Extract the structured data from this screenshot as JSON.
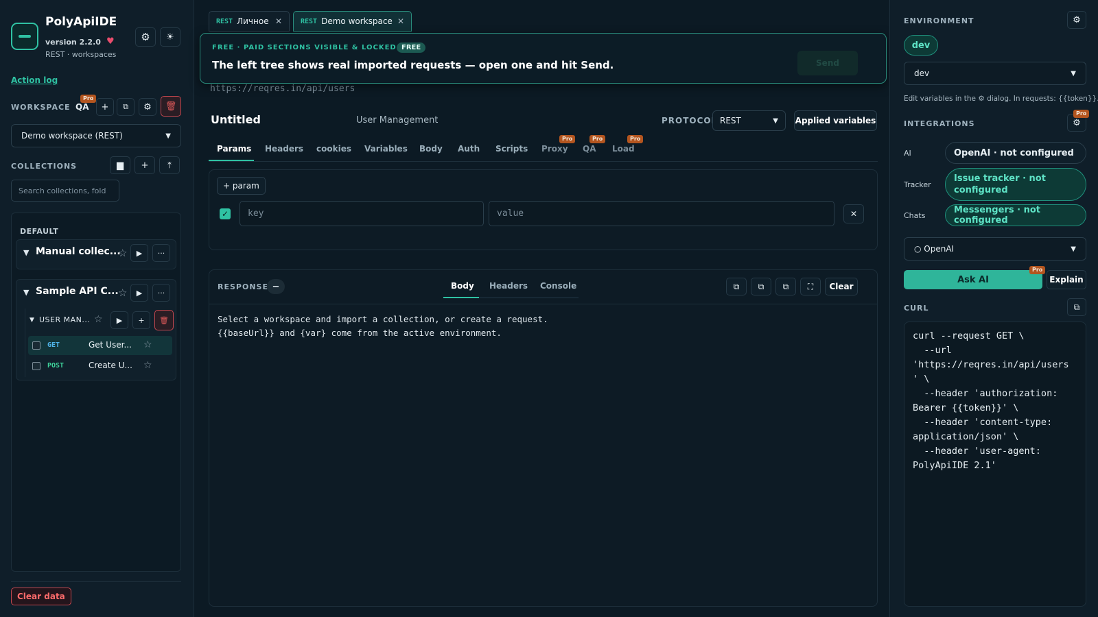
{
  "app": {
    "name": "PolyApiIDE",
    "version": "version 2.2.0",
    "subtitle": "REST · workspaces"
  },
  "sidebar": {
    "action_log": "Action log",
    "workspace_label": "WORKSPACE",
    "workspace_badge": "QA",
    "pro": "Pro",
    "workspace_select": "Demo workspace (REST)",
    "collections_label": "COLLECTIONS",
    "search_placeholder": "Search collections, fold",
    "group_label": "DEFAULT",
    "collections": [
      {
        "name": "Manual collec..."
      },
      {
        "name": "Sample API C..."
      }
    ],
    "folder": {
      "name": "USER MAN..."
    },
    "requests": [
      {
        "method": "GET",
        "name": "Get User..."
      },
      {
        "method": "POST",
        "name": "Create U..."
      }
    ],
    "clear_data": "Clear data"
  },
  "tabs_bar": [
    {
      "proto": "REST",
      "title": "Личное"
    },
    {
      "proto": "REST",
      "title": "Demo workspace"
    }
  ],
  "banner": {
    "kicker": "FREE · PAID SECTIONS VISIBLE & LOCKED",
    "badge": "FREE",
    "message": "The left tree shows real imported requests — open one and hit Send.",
    "send": "Send"
  },
  "request": {
    "url": "https://reqres.in/api/users",
    "name": "Untitled",
    "collection": "User Management",
    "protocol_label": "PROTOCOL",
    "protocol": "REST",
    "applied_vars": "Applied variables",
    "tabs": [
      "Params",
      "Headers",
      "cookies",
      "Variables",
      "Body",
      "Auth",
      "Scripts",
      "Proxy",
      "QA",
      "Load"
    ],
    "add_param": "+ param",
    "key_placeholder": "key",
    "value_placeholder": "value"
  },
  "response": {
    "label": "RESPONSE",
    "tabs": [
      "Body",
      "Headers",
      "Console"
    ],
    "clear": "Clear",
    "body_line1": "Select a workspace and import a collection, or create a request.",
    "body_line2": "{{baseUrl}} and {var} come from the active environment."
  },
  "right": {
    "env_label": "ENVIRONMENT",
    "env_chip": "dev",
    "env_select": "dev",
    "env_hint": "Edit variables in the ⚙ dialog. In requests: {{token}}.",
    "integrations_label": "INTEGRATIONS",
    "integrations": [
      {
        "label": "AI",
        "value": "OpenAI · not configured"
      },
      {
        "label": "Tracker",
        "value": "Issue tracker · not configured"
      },
      {
        "label": "Chats",
        "value": "Messengers · not configured"
      }
    ],
    "ai_select": "○ OpenAI",
    "ask_ai": "Ask AI",
    "explain": "Explain",
    "curl_label": "CURL",
    "curl_lines": [
      "curl --request GET \\",
      "  --url",
      "'https://reqres.in/api/users",
      "' \\",
      "  --header 'authorization:",
      "Bearer {{token}}' \\",
      "  --header 'content-type:",
      "application/json' \\",
      "  --header 'user-agent:",
      "PolyApiIDE 2.1'"
    ]
  },
  "colors": {
    "accent": "#2fc2a3",
    "danger": "#e05a5a",
    "bg": "#0c1a24",
    "pro": "#b3551f"
  }
}
